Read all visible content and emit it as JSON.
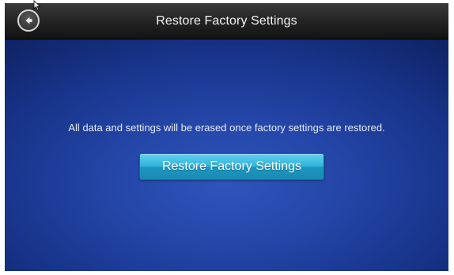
{
  "header": {
    "title": "Restore Factory Settings",
    "back_icon": "back-arrow-icon"
  },
  "main": {
    "message": "All data and settings will be erased once factory settings are restored.",
    "restore_button_label": "Restore Factory Settings"
  },
  "colors": {
    "header_background": "#1e1e1e",
    "content_background": "#2446a8",
    "button_accent": "#33b3da",
    "text_primary": "#ffffff"
  }
}
